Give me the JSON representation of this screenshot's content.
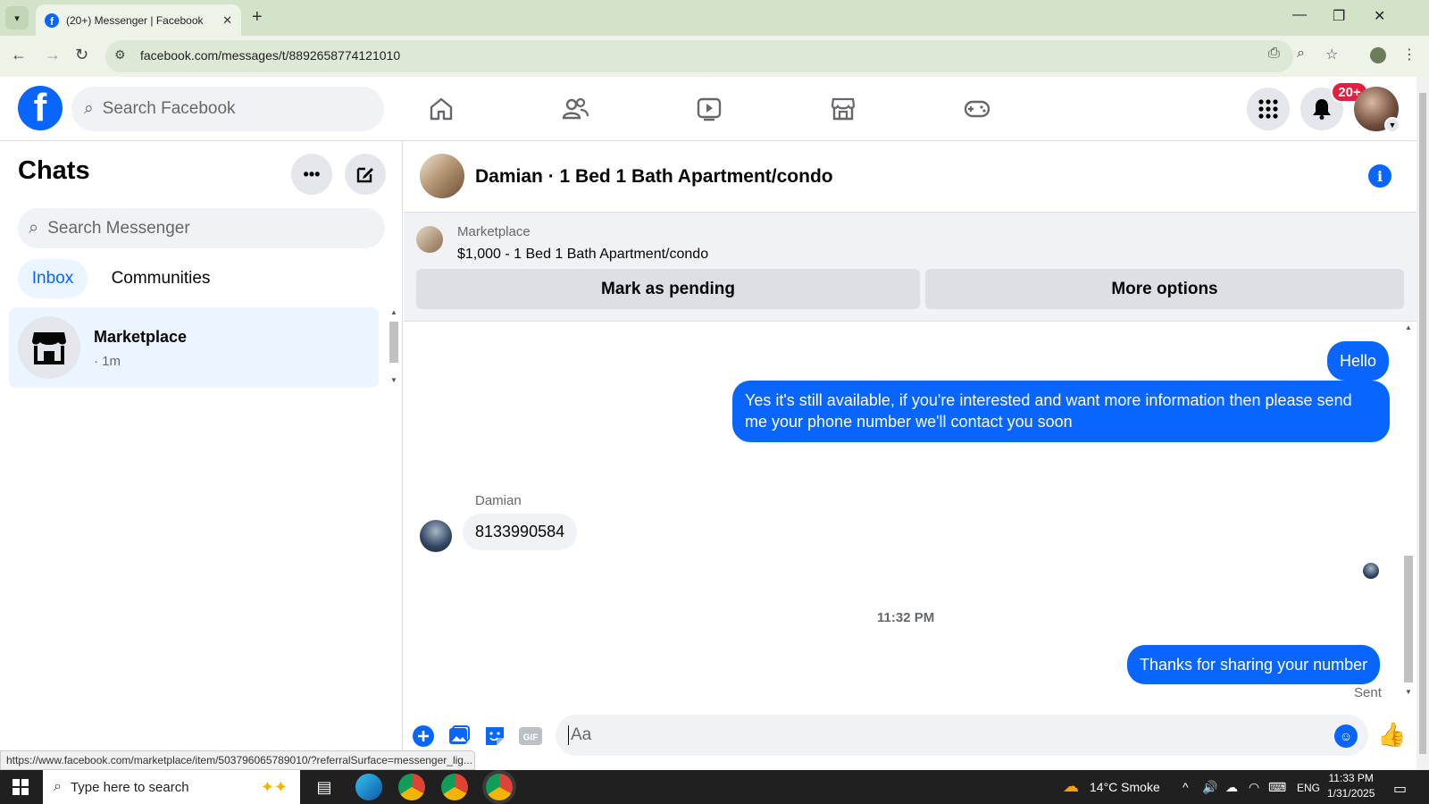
{
  "browser": {
    "tab_title": "(20+) Messenger | Facebook",
    "url": "facebook.com/messages/t/8892658774121010",
    "status_url": "https://www.facebook.com/marketplace/item/503796065789010/?referralSurface=messenger_lig..."
  },
  "header": {
    "search_placeholder": "Search Facebook",
    "notification_badge": "20+"
  },
  "sidebar": {
    "title": "Chats",
    "search_placeholder": "Search Messenger",
    "tabs": [
      "Inbox",
      "Communities"
    ],
    "chats": [
      {
        "name": "Marketplace",
        "time": "· 1m"
      }
    ]
  },
  "conversation": {
    "title": "Damian · 1 Bed 1 Bath Apartment/condo",
    "marketplace_label": "Marketplace",
    "listing": "$1,000 - 1 Bed 1 Bath Apartment/condo",
    "mark_pending_label": "Mark as pending",
    "more_options_label": "More options",
    "messages": [
      {
        "from": "me",
        "text": "Hello"
      },
      {
        "from": "me",
        "text": "Yes it's still available, if you're interested and want more information then please send me your phone number we'll contact you soon"
      },
      {
        "from": "Damian",
        "text": "8133990584"
      },
      {
        "from": "me",
        "text": "Thanks for sharing your number"
      }
    ],
    "sender_name": "Damian",
    "timestamp": "11:32 PM",
    "sent_label": "Sent",
    "composer_placeholder": "Aa"
  },
  "taskbar": {
    "search_placeholder": "Type here to search",
    "weather": "14°C  Smoke",
    "language": "ENG",
    "time": "11:33 PM",
    "date": "1/31/2025"
  },
  "colors": {
    "accent": "#0866ff",
    "badge": "#e41e3f",
    "chrome_bg": "#d3e3c9"
  }
}
